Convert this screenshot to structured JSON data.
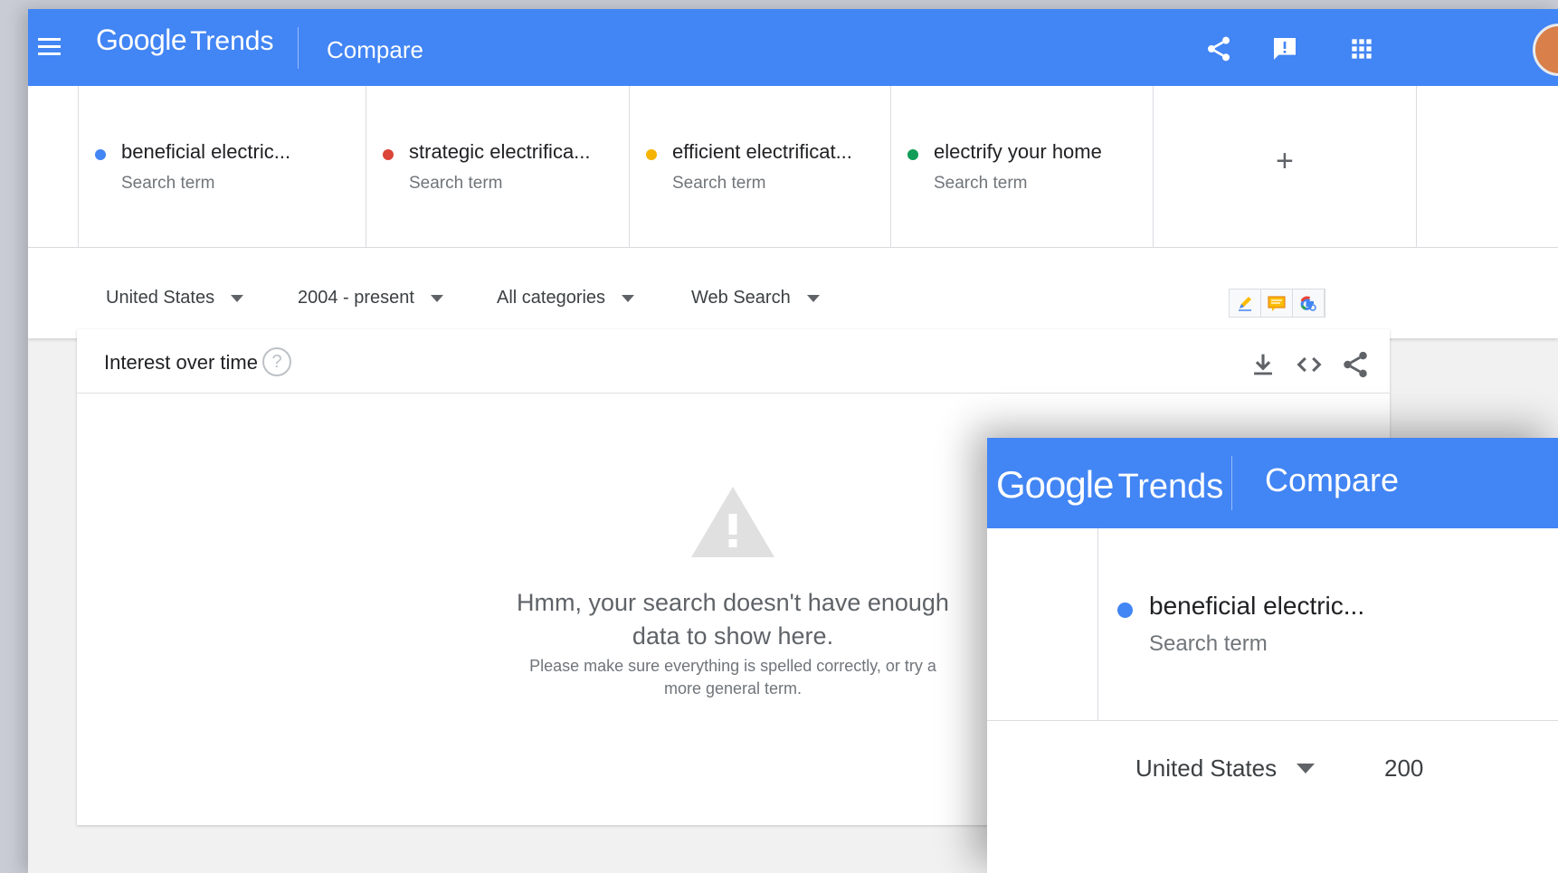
{
  "header": {
    "logo_google": "Google",
    "logo_trends": "Trends",
    "page_title": "Compare",
    "icons": [
      "share-icon",
      "feedback-icon",
      "apps-icon",
      "avatar"
    ]
  },
  "terms": [
    {
      "name": "beneficial electric...",
      "type": "Search term",
      "color": "#4285f4"
    },
    {
      "name": "strategic electrifica...",
      "type": "Search term",
      "color": "#db4437"
    },
    {
      "name": "efficient electrificat...",
      "type": "Search term",
      "color": "#f4b400"
    },
    {
      "name": "electrify your home",
      "type": "Search term",
      "color": "#0f9d58"
    }
  ],
  "add_term": {
    "label": "+"
  },
  "filters": {
    "region": "United States",
    "time": "2004 - present",
    "category": "All categories",
    "search_type": "Web Search"
  },
  "panel": {
    "title": "Interest over time",
    "help": "?",
    "message_main": "Hmm, your search doesn't have enough data to show here.",
    "message_sub": "Please make sure everything is spelled correctly, or try a more general term."
  },
  "zoom": {
    "logo_google": "Google",
    "logo_trends": "Trends",
    "page_title": "Compare",
    "term_name": "beneficial electric...",
    "term_type": "Search term",
    "term_color": "#4285f4",
    "region": "United States",
    "time_partial": "200"
  },
  "colors": {
    "brand_blue": "#4285f4"
  }
}
